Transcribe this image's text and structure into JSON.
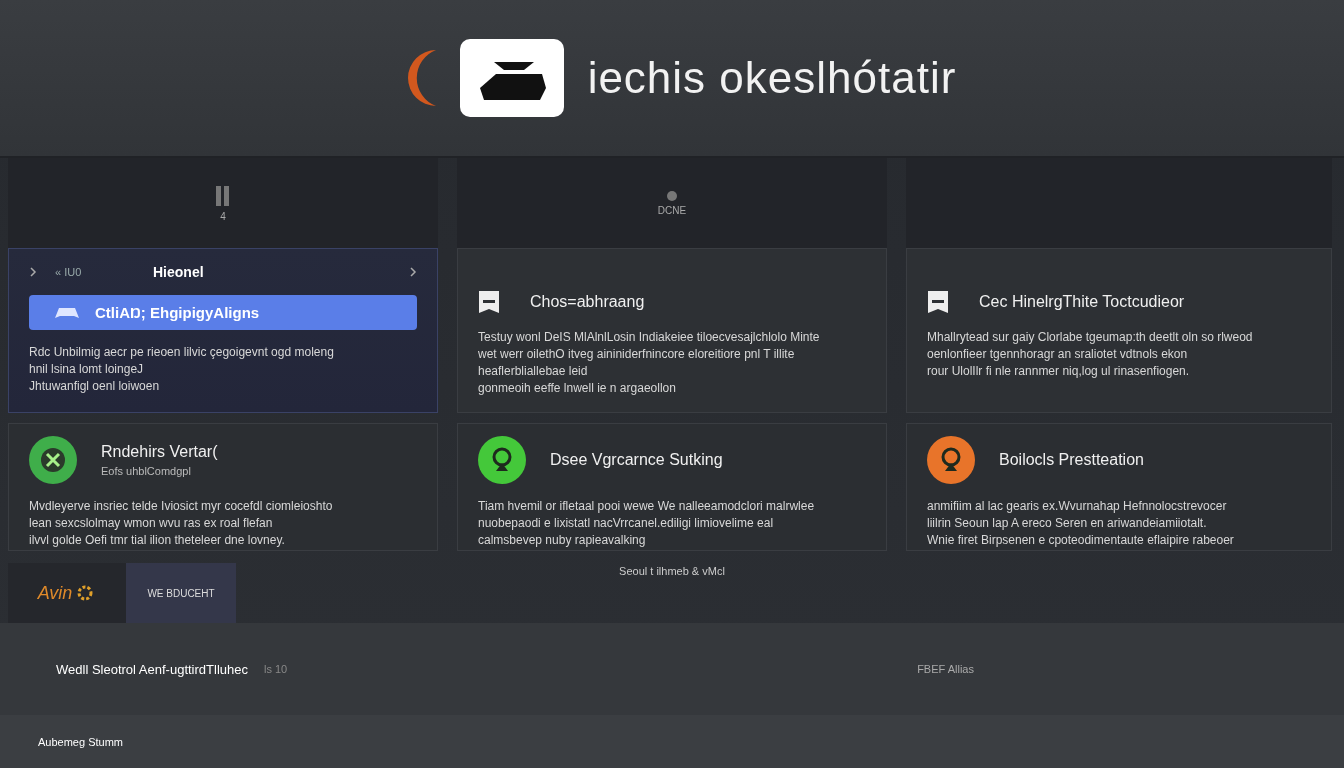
{
  "header": {
    "title": "iechis okeslhótatir"
  },
  "column_headers": [
    {
      "kind": "bars",
      "label": "4"
    },
    {
      "kind": "dot",
      "label": "DCNE"
    },
    {
      "kind": "empty"
    }
  ],
  "top_cards": [
    {
      "selected": true,
      "kind": "nav",
      "nav_label": "« IU0",
      "title": "Hieonel",
      "action": "CtliAŊ; EhgipigyAligns",
      "body": "Rdc Unbilmig aecr pe rieoen lilvic çegoigevnt ogd moleng\nhnil lsina lomt loingeJ\nJhtuwanfigl oenl loiwoen"
    },
    {
      "selected": false,
      "kind": "feature",
      "title": "Chos=abhraang",
      "body": "Testuy wonl DeIS MlAlnlLosin Indiakeiee tiloecvesajlchlolo Minte\nwet werr oilethO itveg aininiderfnincore eloreitiore pnl T illite\nheaflerbliallebae leid\ngonmeoih eeffe lnwell ie n argaeollon"
    },
    {
      "selected": false,
      "kind": "feature",
      "title": "Cec HinelrgThite Toctcudieor",
      "body": "Mhallrytead sur gaiy Clorlabe tgeumap:th deetlt oln so rlweod\noenlonfieer tgennhoragr an sraliotet vdtnols ekon\nrour UlolIlr fi nle rannmer niq,log ul rinasenfiogen."
    }
  ],
  "bottom_cards": [
    {
      "color": "#3fae4a",
      "kind": "x",
      "title": "Rndehirs Vertar(",
      "subtitle": "Eofs uhblComdgpl",
      "body": "Mvdleyerve insriec telde Iviosict myr cocefdl ciomleioshto\nlean sexcslolmay wmon wvu ras ex roal flefan\nilvvl golde Oefi tmr tial ilion theteleer dne lovney."
    },
    {
      "color": "#44c83a",
      "kind": "pin",
      "title": "Dsee Vgrcarnce Sutking",
      "body": "Tiam hvemil or ifletaal pooi wewe We nalleeamodclori malrwlee\nnuobepaodi e lixistatl nacVrrcanel.ediligi limiovelime eal\ncalmsbevep nuby rapieavalking"
    },
    {
      "color": "#e8742a",
      "kind": "pin",
      "title": "Boilocls Prestteation",
      "body": "anmifiim al lac gearis ex.Wvurnahap Hefnnolocstrevocer\nliilrin Seoun lap A ereco Seren en ariwandeiamiiotalt.\nWnie firet Birpsenen e cpoteodimentaute eflaipire rabeoer"
    }
  ],
  "brand_tile": {
    "logo": "Avin",
    "label": "WE BDUCEHT"
  },
  "caption": "Seoul t ilhmeb & vMcl",
  "footer": {
    "title": "Wedll Sleotrol Aenf-ugttirdTlluhec",
    "count": "ls 10",
    "right": "FBEF Allias"
  },
  "status_bar": "Aubemeg Stumm"
}
